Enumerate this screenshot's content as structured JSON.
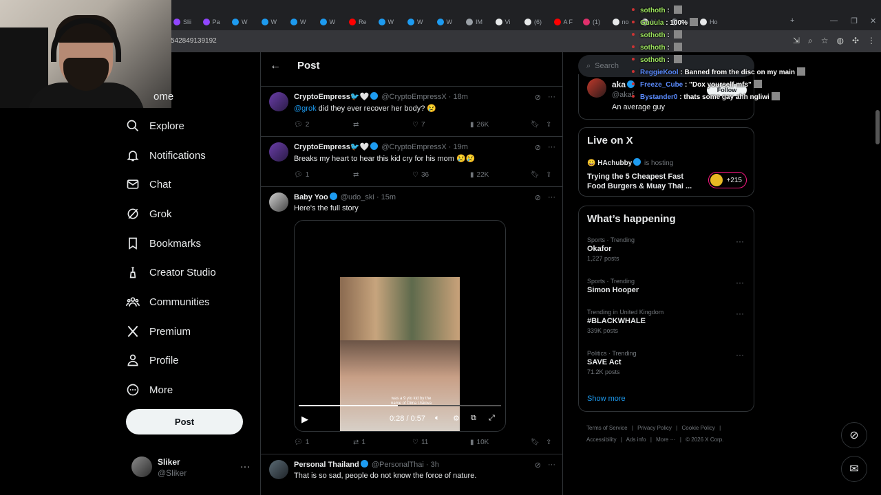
{
  "browser": {
    "tabs": [
      {
        "label": "Slii",
        "color": "#9146ff"
      },
      {
        "label": "Pa",
        "color": "#9146ff"
      },
      {
        "label": "W",
        "color": "#1d9bf0"
      },
      {
        "label": "W",
        "color": "#1d9bf0"
      },
      {
        "label": "W",
        "color": "#1d9bf0"
      },
      {
        "label": "W",
        "color": "#1d9bf0"
      },
      {
        "label": "Re",
        "color": "#ff0000"
      },
      {
        "label": "W",
        "color": "#1d9bf0"
      },
      {
        "label": "W",
        "color": "#1d9bf0"
      },
      {
        "label": "W",
        "color": "#1d9bf0"
      },
      {
        "label": "IM",
        "color": "#9aa0a6"
      },
      {
        "label": "Vi",
        "color": "#e7e9ea"
      },
      {
        "label": "(6)",
        "color": "#e7e9ea"
      },
      {
        "label": "A F",
        "color": "#ff0000"
      },
      {
        "label": "(1)",
        "color": "#e1306c"
      },
      {
        "label": "no",
        "color": "#e7e9ea"
      },
      {
        "label": "bi",
        "color": "#e7e9ea"
      },
      {
        "label": "Co",
        "color": "#9aa0a6"
      },
      {
        "label": "Ho",
        "color": "#e7e9ea"
      }
    ],
    "url": "542849139192"
  },
  "sidebar": {
    "items": [
      {
        "label": "ome",
        "icon": "home-icon"
      },
      {
        "label": "Explore",
        "icon": "search-icon"
      },
      {
        "label": "Notifications",
        "icon": "bell-icon"
      },
      {
        "label": "Chat",
        "icon": "mail-icon"
      },
      {
        "label": "Grok",
        "icon": "grok-icon"
      },
      {
        "label": "Bookmarks",
        "icon": "bookmark-icon"
      },
      {
        "label": "Creator Studio",
        "icon": "creator-icon"
      },
      {
        "label": "Communities",
        "icon": "communities-icon"
      },
      {
        "label": "Premium",
        "icon": "x-logo-icon"
      },
      {
        "label": "Profile",
        "icon": "person-icon"
      },
      {
        "label": "More",
        "icon": "more-circle-icon"
      }
    ],
    "post_label": "Post",
    "profile": {
      "name": "Sliker",
      "handle": "@Sliker",
      "more": "···"
    }
  },
  "main": {
    "title": "Post",
    "tweets": [
      {
        "name": "CryptoEmpress🐦🤍",
        "handle": "@CryptoEmpressX",
        "time": "· 18m",
        "mention": "@grok",
        "text": " did they ever recover her body? 😢",
        "replies": "2",
        "reposts": "",
        "likes": "7",
        "views": "26K"
      },
      {
        "name": "CryptoEmpress🐦🤍",
        "handle": "@CryptoEmpressX",
        "time": "· 19m",
        "mention": "",
        "text": "Breaks my heart to hear this kid cry for his mom 😢😢",
        "replies": "1",
        "reposts": "",
        "likes": "36",
        "views": "22K"
      },
      {
        "name": "Baby Yoo",
        "handle": "@udo_ski",
        "time": "· 15m",
        "mention": "",
        "text": "Here's the full story",
        "replies": "1",
        "reposts": "1",
        "likes": "11",
        "views": "10K"
      },
      {
        "name": "Personal Thailand",
        "handle": "@PersonalThai",
        "time": "· 3h",
        "mention": "",
        "text": "That is so sad, people do not know the force of nature.",
        "replies": "",
        "reposts": "",
        "likes": "",
        "views": ""
      }
    ],
    "video": {
      "time": "0:28 / 0:57",
      "progress": 0.49,
      "caption_line1": "was a 9 y/o kid by the",
      "caption_line2": "name of Dima Uskova"
    }
  },
  "right": {
    "search_placeholder": "Search",
    "who_to_follow": {
      "name": "aka",
      "handle": "@akaf",
      "bio": "An average guy",
      "follow_label": "Follow"
    },
    "live": {
      "title": "Live on X",
      "host": "HAchubby",
      "hosting": "is hosting",
      "topic_line1": "Trying the 5 Cheapest Fast",
      "topic_line2": "Food Burgers & Muay Thai ...",
      "listeners": "+215"
    },
    "happening": {
      "title": "What’s happening",
      "trends": [
        {
          "category": "Sports · Trending",
          "name": "Okafor",
          "count": "1,227 posts"
        },
        {
          "category": "Sports · Trending",
          "name": "Simon Hooper",
          "count": ""
        },
        {
          "category": "Trending in United Kingdom",
          "name": "#BLACKWHALE",
          "count": "339K posts"
        },
        {
          "category": "Politics · Trending",
          "name": "SAVE Act",
          "count": "71.2K posts"
        }
      ],
      "show_more": "Show more"
    },
    "footer": {
      "line1": [
        "Terms of Service",
        "Privacy Policy",
        "Cookie Policy"
      ],
      "line2": [
        "Accessibility",
        "Ads info",
        "More ···",
        "© 2026 X Corp."
      ]
    }
  },
  "chat": [
    {
      "user": "sothoth",
      "color": "#9be15d",
      "msg": ""
    },
    {
      "user": "Guuula",
      "color": "#9be15d",
      "msg": "100%"
    },
    {
      "user": "sothoth",
      "color": "#9be15d",
      "msg": ""
    },
    {
      "user": "sothoth",
      "color": "#9be15d",
      "msg": ""
    },
    {
      "user": "sothoth",
      "color": "#9be15d",
      "msg": ""
    },
    {
      "user": "ReggieKool",
      "color": "#5b8cff",
      "msg": "Banned from the disc on my main"
    },
    {
      "user": "Freeze_Cube",
      "color": "#5b8cff",
      "msg": "\"Dox yourself mfs\""
    },
    {
      "user": "Bystander0",
      "color": "#5b8cff",
      "msg": "thats some gay ahh ngliwi"
    }
  ],
  "colors": {
    "accent": "#1d9bf0",
    "bg": "#000000",
    "border": "#2f3336",
    "muted": "#71767b"
  }
}
